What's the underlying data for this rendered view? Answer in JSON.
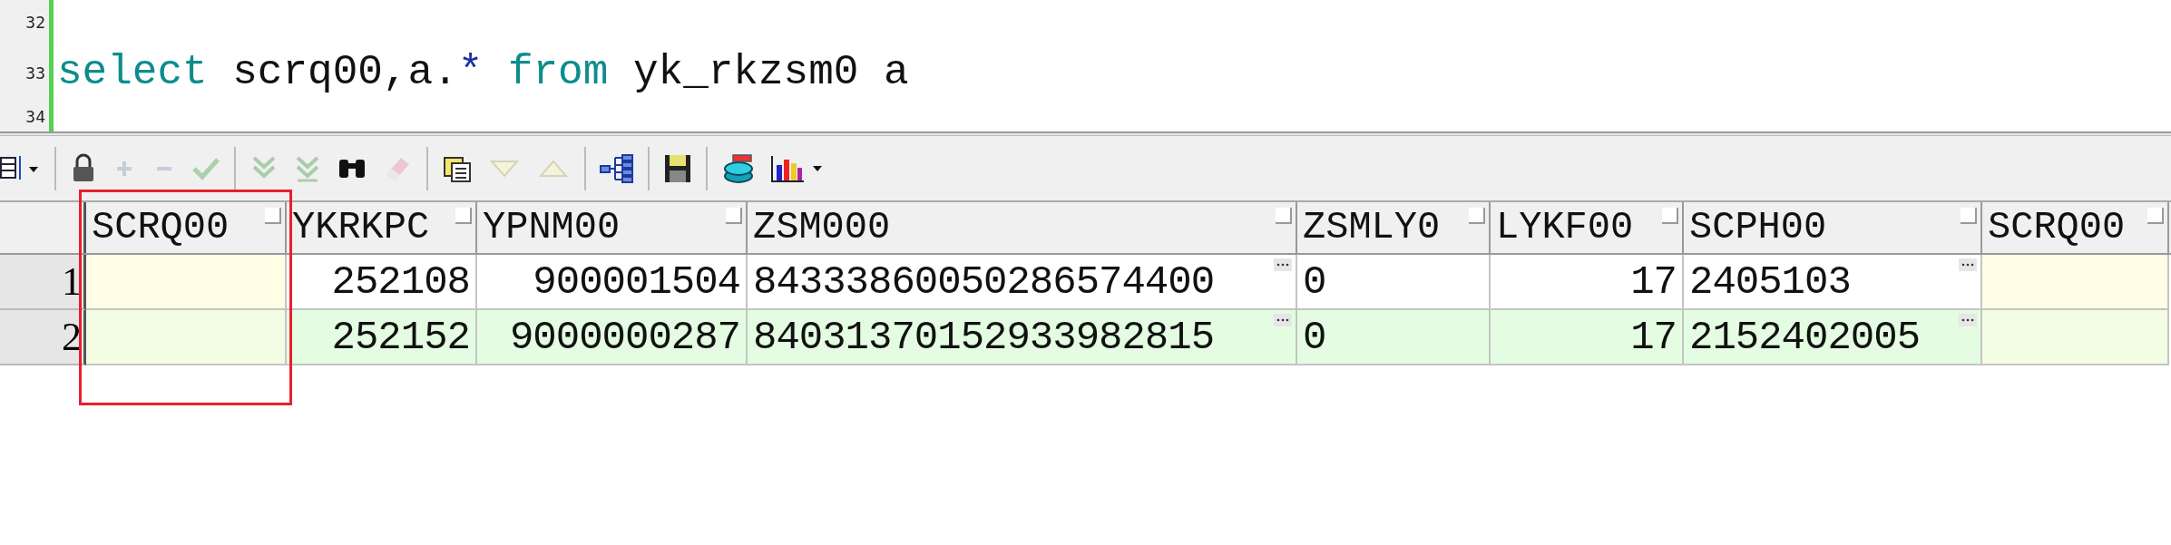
{
  "editor": {
    "lines": [
      {
        "number": "32"
      },
      {
        "number": "33",
        "tokens": [
          {
            "text": "select",
            "kind": "keyword"
          },
          {
            "text": " scrq00,a.",
            "kind": "plain"
          },
          {
            "text": "*",
            "kind": "operator"
          },
          {
            "text": " from",
            "kind": "keyword"
          },
          {
            "text": " yk_rkzsm0 a",
            "kind": "plain"
          }
        ]
      },
      {
        "number": "34"
      }
    ]
  },
  "toolbar": [
    {
      "kind": "grid",
      "disabled": false
    },
    {
      "kind": "sep"
    },
    {
      "kind": "lock",
      "disabled": false
    },
    {
      "kind": "plus",
      "disabled": true
    },
    {
      "kind": "minus",
      "disabled": true
    },
    {
      "kind": "check",
      "disabled": true
    },
    {
      "kind": "sep"
    },
    {
      "kind": "fetch",
      "disabled": true
    },
    {
      "kind": "fetch-all",
      "disabled": true
    },
    {
      "kind": "find",
      "disabled": false
    },
    {
      "kind": "eraser",
      "disabled": true
    },
    {
      "kind": "sep"
    },
    {
      "kind": "notes",
      "disabled": false
    },
    {
      "kind": "down",
      "disabled": true
    },
    {
      "kind": "up",
      "disabled": true
    },
    {
      "kind": "sep"
    },
    {
      "kind": "tree",
      "disabled": false
    },
    {
      "kind": "sep"
    },
    {
      "kind": "save",
      "disabled": false
    },
    {
      "kind": "sep"
    },
    {
      "kind": "database",
      "disabled": false
    },
    {
      "kind": "chart",
      "disabled": false
    }
  ],
  "table": {
    "columns": [
      {
        "label": "SCRQ00",
        "kind": "date"
      },
      {
        "label": "YKRKPC",
        "kind": "number"
      },
      {
        "label": "YPNM00",
        "kind": "number"
      },
      {
        "label": "ZSM000",
        "kind": "long"
      },
      {
        "label": "ZSMLY0",
        "kind": "text"
      },
      {
        "label": "LYKF00",
        "kind": "number"
      },
      {
        "label": "SCPH00",
        "kind": "long"
      },
      {
        "label": "SCRQ00",
        "kind": "date"
      }
    ],
    "rows": [
      {
        "number": "1",
        "highlighted": false,
        "cells": [
          null,
          "252108",
          "900001504",
          "84333860050286574400",
          "0",
          "17",
          "2405103",
          null
        ]
      },
      {
        "number": "2",
        "highlighted": true,
        "cells": [
          null,
          "252152",
          "9000000287",
          "84031370152933982815",
          "0",
          "17",
          "2152402005",
          null
        ]
      }
    ]
  }
}
